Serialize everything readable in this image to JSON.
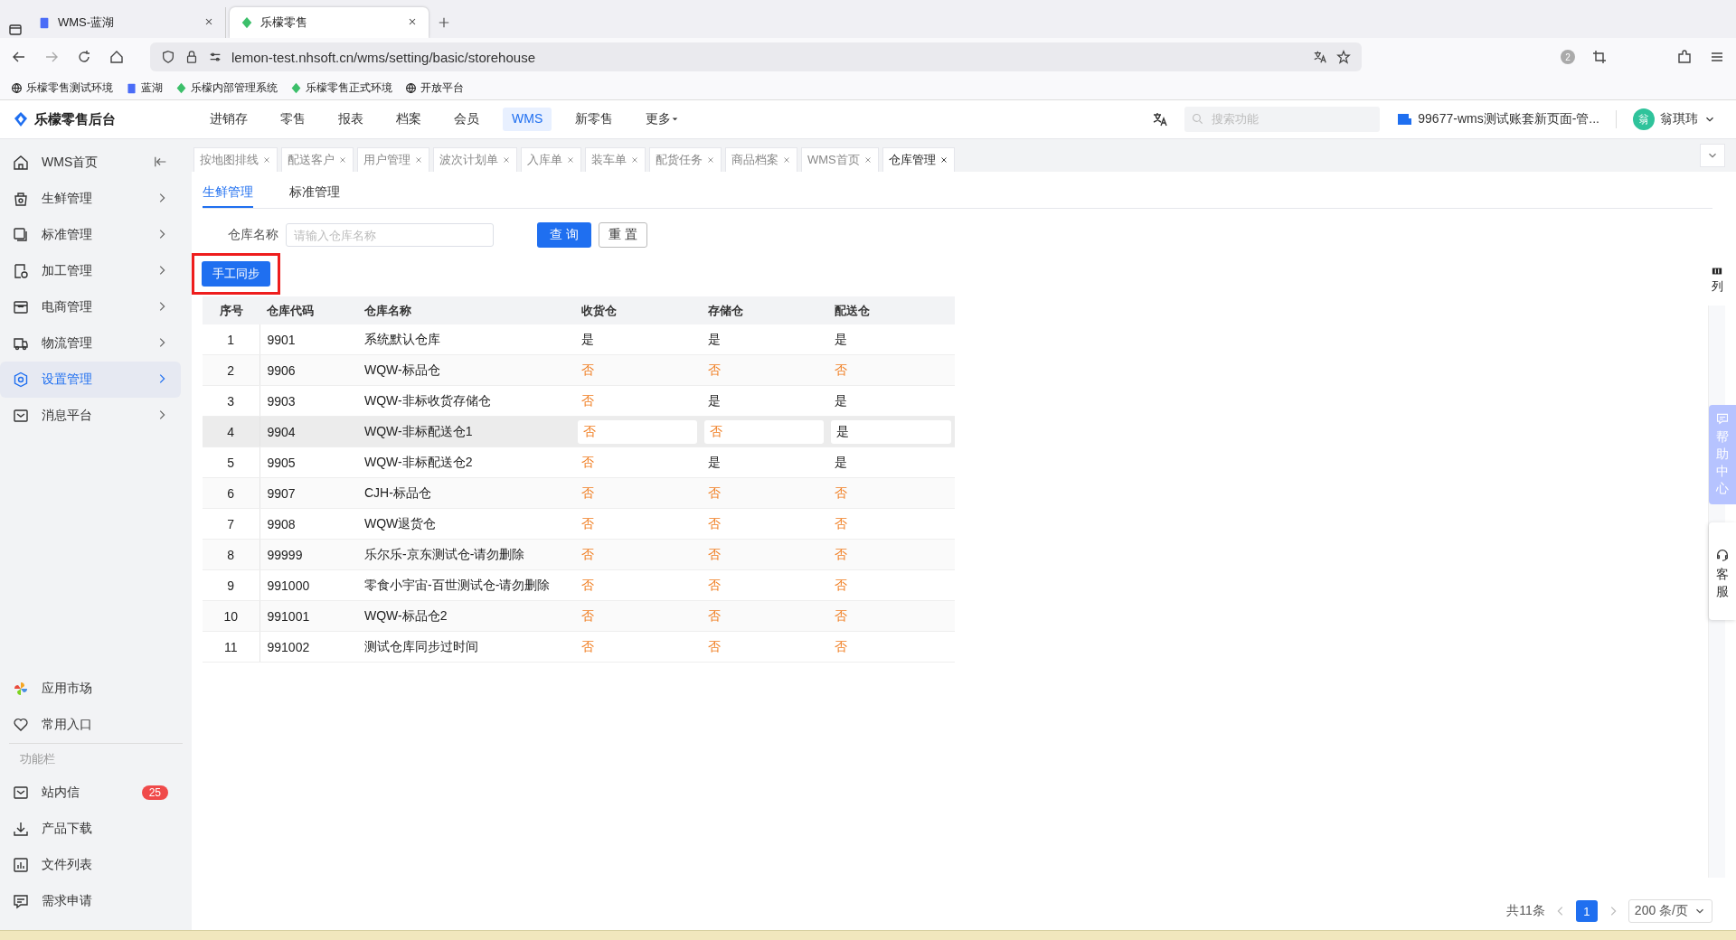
{
  "browser": {
    "tabs": [
      {
        "title": "WMS-蓝湖",
        "selected": false
      },
      {
        "title": "乐檬零售",
        "selected": true
      }
    ],
    "url": "lemon-test.nhsoft.cn/wms/setting/basic/storehouse",
    "extension_badge": "2",
    "bookmarks": [
      "乐檬零售测试环境",
      "蓝湖",
      "乐檬内部管理系统",
      "乐檬零售正式环境",
      "开放平台"
    ]
  },
  "header": {
    "logo": "乐檬零售后台",
    "nav": [
      {
        "label": "进销存",
        "selected": false
      },
      {
        "label": "零售",
        "selected": false
      },
      {
        "label": "报表",
        "selected": false
      },
      {
        "label": "档案",
        "selected": false
      },
      {
        "label": "会员",
        "selected": false
      },
      {
        "label": "WMS",
        "selected": true
      },
      {
        "label": "新零售",
        "selected": false
      },
      {
        "label": "更多",
        "selected": false
      }
    ],
    "search": {
      "placeholder": "搜索功能"
    },
    "account": "99677-wms测试账套新页面-管...",
    "avatar": "翁",
    "user": "翁琪玮"
  },
  "sidebar": {
    "items": [
      {
        "label": "WMS首页",
        "selected": false
      },
      {
        "label": "生鲜管理",
        "selected": false
      },
      {
        "label": "标准管理",
        "selected": false
      },
      {
        "label": "加工管理",
        "selected": false
      },
      {
        "label": "电商管理",
        "selected": false
      },
      {
        "label": "物流管理",
        "selected": false
      },
      {
        "label": "设置管理",
        "selected": true
      },
      {
        "label": "消息平台",
        "selected": false
      }
    ],
    "bottom": [
      "应用市场",
      "常用入口"
    ],
    "section": "功能栏",
    "tools": [
      {
        "label": "站内信",
        "badge": "25"
      },
      {
        "label": "产品下载"
      },
      {
        "label": "文件列表"
      },
      {
        "label": "需求申请"
      }
    ]
  },
  "page_tabs": [
    {
      "label": "按地图排线",
      "selected": false
    },
    {
      "label": "配送客户",
      "selected": false
    },
    {
      "label": "用户管理",
      "selected": false
    },
    {
      "label": "波次计划单",
      "selected": false
    },
    {
      "label": "入库单",
      "selected": false
    },
    {
      "label": "装车单",
      "selected": false
    },
    {
      "label": "配货任务",
      "selected": false
    },
    {
      "label": "商品档案",
      "selected": false
    },
    {
      "label": "WMS首页",
      "selected": false
    },
    {
      "label": "仓库管理",
      "selected": true
    }
  ],
  "sub_tabs": [
    {
      "label": "生鲜管理",
      "selected": true
    },
    {
      "label": "标准管理",
      "selected": false
    }
  ],
  "filter": {
    "label": "仓库名称",
    "placeholder": "请输入仓库名称",
    "query": "查 询",
    "reset": "重 置"
  },
  "sync_button": {
    "label": "手工同步",
    "highlighted": true
  },
  "table": {
    "columns": [
      "序号",
      "仓库代码",
      "仓库名称",
      "收货仓",
      "存储仓",
      "配送仓"
    ],
    "rows": [
      {
        "no": "1",
        "code": "9901",
        "name": "系统默认仓库",
        "hovered": false,
        "flags": [
          {
            "text": "是",
            "yes": true
          },
          {
            "text": "是",
            "yes": true
          },
          {
            "text": "是",
            "yes": true
          }
        ]
      },
      {
        "no": "2",
        "code": "9906",
        "name": "WQW-标品仓",
        "hovered": false,
        "flags": [
          {
            "text": "否",
            "yes": false
          },
          {
            "text": "否",
            "yes": false
          },
          {
            "text": "否",
            "yes": false
          }
        ]
      },
      {
        "no": "3",
        "code": "9903",
        "name": "WQW-非标收货存储仓",
        "hovered": false,
        "flags": [
          {
            "text": "否",
            "yes": false
          },
          {
            "text": "是",
            "yes": true
          },
          {
            "text": "是",
            "yes": true
          }
        ]
      },
      {
        "no": "4",
        "code": "9904",
        "name": "WQW-非标配送仓1",
        "hovered": true,
        "flags": [
          {
            "text": "否",
            "yes": false
          },
          {
            "text": "否",
            "yes": false
          },
          {
            "text": "是",
            "yes": true
          }
        ]
      },
      {
        "no": "5",
        "code": "9905",
        "name": "WQW-非标配送仓2",
        "hovered": false,
        "flags": [
          {
            "text": "否",
            "yes": false
          },
          {
            "text": "是",
            "yes": true
          },
          {
            "text": "是",
            "yes": true
          }
        ]
      },
      {
        "no": "6",
        "code": "9907",
        "name": "CJH-标品仓",
        "hovered": false,
        "flags": [
          {
            "text": "否",
            "yes": false
          },
          {
            "text": "否",
            "yes": false
          },
          {
            "text": "否",
            "yes": false
          }
        ]
      },
      {
        "no": "7",
        "code": "9908",
        "name": "WQW退货仓",
        "hovered": false,
        "flags": [
          {
            "text": "否",
            "yes": false
          },
          {
            "text": "否",
            "yes": false
          },
          {
            "text": "否",
            "yes": false
          }
        ]
      },
      {
        "no": "8",
        "code": "99999",
        "name": "乐尔乐-京东测试仓-请勿删除",
        "hovered": false,
        "flags": [
          {
            "text": "否",
            "yes": false
          },
          {
            "text": "否",
            "yes": false
          },
          {
            "text": "否",
            "yes": false
          }
        ]
      },
      {
        "no": "9",
        "code": "991000",
        "name": "零食小宇宙-百世测试仓-请勿删除",
        "hovered": false,
        "flags": [
          {
            "text": "否",
            "yes": false
          },
          {
            "text": "否",
            "yes": false
          },
          {
            "text": "否",
            "yes": false
          }
        ]
      },
      {
        "no": "10",
        "code": "991001",
        "name": "WQW-标品仓2",
        "hovered": false,
        "flags": [
          {
            "text": "否",
            "yes": false
          },
          {
            "text": "否",
            "yes": false
          },
          {
            "text": "否",
            "yes": false
          }
        ]
      },
      {
        "no": "11",
        "code": "991002",
        "name": "测试仓库同步过时间",
        "hovered": false,
        "flags": [
          {
            "text": "否",
            "yes": false
          },
          {
            "text": "否",
            "yes": false
          },
          {
            "text": "否",
            "yes": false
          }
        ]
      }
    ],
    "column_setting": "列"
  },
  "pagination": {
    "total": "共11条",
    "pages": [
      {
        "label": "1",
        "selected": true
      }
    ],
    "page_size": "200 条/页"
  },
  "float": {
    "help": "帮助中心",
    "service": "客服"
  }
}
